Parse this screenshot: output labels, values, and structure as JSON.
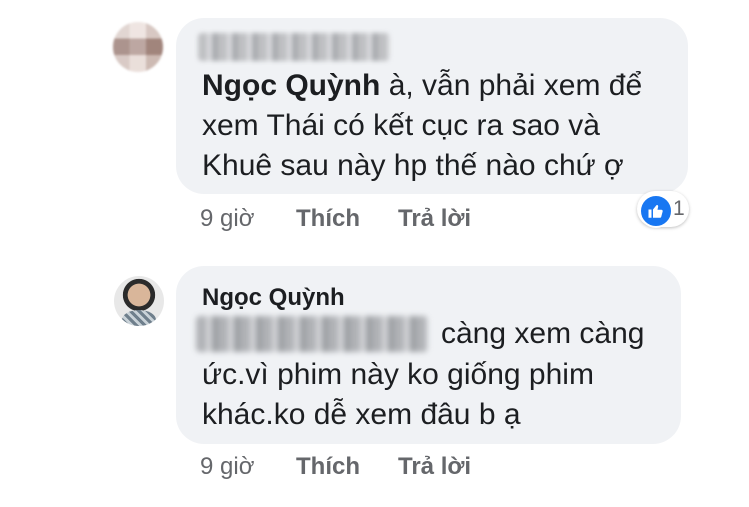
{
  "comments": [
    {
      "author_blurred": true,
      "mention": "Ngọc Quỳnh",
      "lines": [
        "à, vẫn phải xem để",
        "xem Thái có kết cục ra sao và",
        "Khuê sau này hp thế nào chứ ợ"
      ],
      "time": "9 giờ",
      "like_label": "Thích",
      "reply_label": "Trả lời",
      "reactions": {
        "icon": "like-icon",
        "count": "1",
        "color": "#1877f2"
      }
    },
    {
      "author": "Ngọc Quỳnh",
      "mention_blurred": true,
      "lines": [
        "càng xem càng",
        "ức.vì phim này ko giống phim",
        "khác.ko dễ xem đâu b ạ"
      ],
      "time": "9 giờ",
      "like_label": "Thích",
      "reply_label": "Trả lời"
    }
  ],
  "colors": {
    "bubble": "#f0f2f5",
    "meta_text": "#65676b",
    "text": "#1c1e21"
  }
}
